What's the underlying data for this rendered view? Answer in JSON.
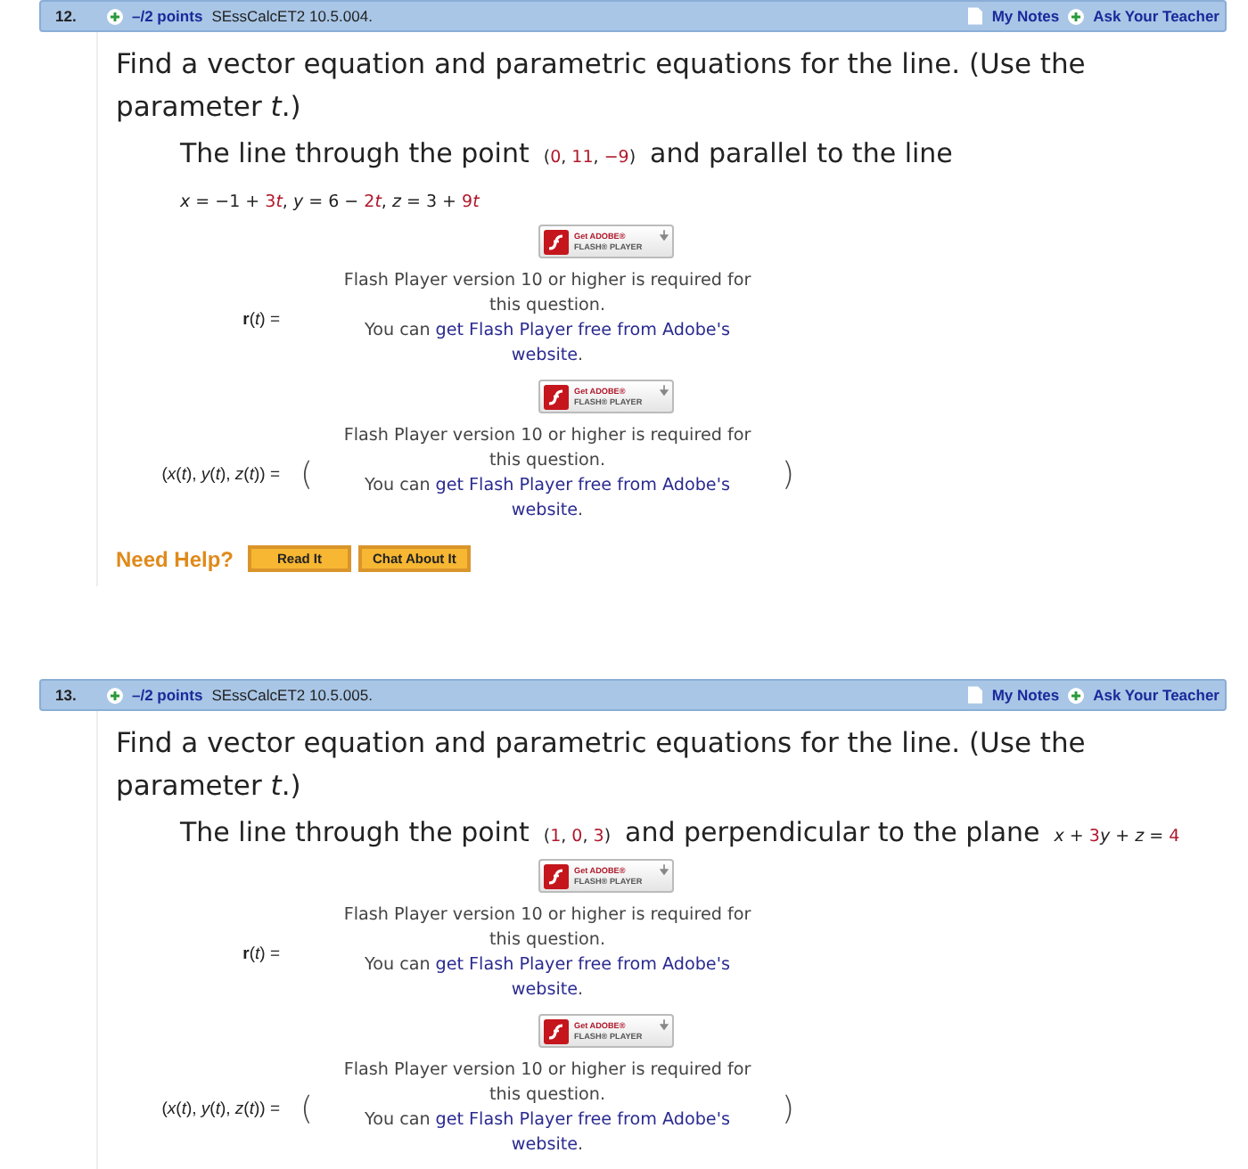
{
  "questions": [
    {
      "number": "12.",
      "points": "–/2 points",
      "code": "SEssCalcET2 10.5.004.",
      "my_notes": "My Notes",
      "ask_teacher": "Ask Your Teacher",
      "prompt": "Find a vector equation and parametric equations for the line. (Use the parameter *t*.)",
      "statement": "The line through the point",
      "point": [
        {
          "kind": "plain",
          "text": "("
        },
        {
          "kind": "value",
          "text": "0"
        },
        {
          "kind": "plain",
          "text": ", "
        },
        {
          "kind": "value",
          "text": "11"
        },
        {
          "kind": "plain",
          "text": ", "
        },
        {
          "kind": "value",
          "text": "−9"
        },
        {
          "kind": "plain",
          "text": ")"
        }
      ],
      "relation": "and parallel to the line",
      "line_equation": [
        {
          "kind": "plain",
          "text": "*x* = −1 + "
        },
        {
          "kind": "value",
          "text": "3"
        },
        {
          "kind": "value",
          "text": "*t*"
        },
        {
          "kind": "plain",
          "text": ", *y* = 6 − "
        },
        {
          "kind": "value",
          "text": "2"
        },
        {
          "kind": "value",
          "text": "*t*"
        },
        {
          "kind": "plain",
          "text": ", *z* = 3 + "
        },
        {
          "kind": "value",
          "text": "9"
        },
        {
          "kind": "value",
          "text": "*t*"
        }
      ],
      "answers": [
        {
          "kind": "vector",
          "label": "**r**(*t*) =",
          "badge_top": "Get ADOBE®",
          "badge_bottom": "FLASH® PLAYER",
          "message": "Flash Player version 10 or higher is required for this question.",
          "lead": "You can",
          "link_lines": [
            "get Flash Player free from Adobe's",
            "website"
          ],
          "tail": "."
        },
        {
          "kind": "parenthesized",
          "label": "(*x*(*t*), *y*(*t*), *z*(*t*))  =",
          "open": "(",
          "close": ")",
          "badge_top": "Get ADOBE®",
          "badge_bottom": "FLASH® PLAYER",
          "message": "Flash Player version 10 or higher is required for this question.",
          "lead": "You can",
          "link_lines": [
            "get Flash Player free from Adobe's",
            "website"
          ],
          "tail": "."
        }
      ],
      "help": {
        "title": "Need Help?",
        "buttons": [
          "Read It",
          "Chat About It"
        ]
      }
    },
    {
      "number": "13.",
      "points": "–/2 points",
      "code": "SEssCalcET2 10.5.005.",
      "my_notes": "My Notes",
      "ask_teacher": "Ask Your Teacher",
      "prompt": "Find a vector equation and parametric equations for the line. (Use the parameter *t*.)",
      "statement": "The line through the point",
      "point": [
        {
          "kind": "plain",
          "text": "("
        },
        {
          "kind": "value",
          "text": "1"
        },
        {
          "kind": "plain",
          "text": ", "
        },
        {
          "kind": "value",
          "text": "0"
        },
        {
          "kind": "plain",
          "text": ", "
        },
        {
          "kind": "value",
          "text": "3"
        },
        {
          "kind": "plain",
          "text": ")"
        }
      ],
      "relation": "and perpendicular to the plane",
      "plane_equation": [
        {
          "kind": "plain",
          "text": "*x* + "
        },
        {
          "kind": "value",
          "text": "3"
        },
        {
          "kind": "plain",
          "text": "*y* + *z* = "
        },
        {
          "kind": "value",
          "text": "4"
        }
      ],
      "answers": [
        {
          "kind": "vector",
          "label": "**r**(*t*) =",
          "badge_top": "Get ADOBE®",
          "badge_bottom": "FLASH® PLAYER",
          "message": "Flash Player version 10 or higher is required for this question.",
          "lead": "You can",
          "link_lines": [
            "get Flash Player free from Adobe's",
            "website"
          ],
          "tail": "."
        },
        {
          "kind": "parenthesized",
          "label": "(*x*(*t*), *y*(*t*), *z*(*t*))  =",
          "open": "(",
          "close": ")",
          "badge_top": "Get ADOBE®",
          "badge_bottom": "FLASH® PLAYER",
          "message": "Flash Player version 10 or higher is required for this question.",
          "lead": "You can",
          "link_lines": [
            "get Flash Player free from Adobe's",
            "website"
          ],
          "tail": "."
        }
      ]
    }
  ]
}
